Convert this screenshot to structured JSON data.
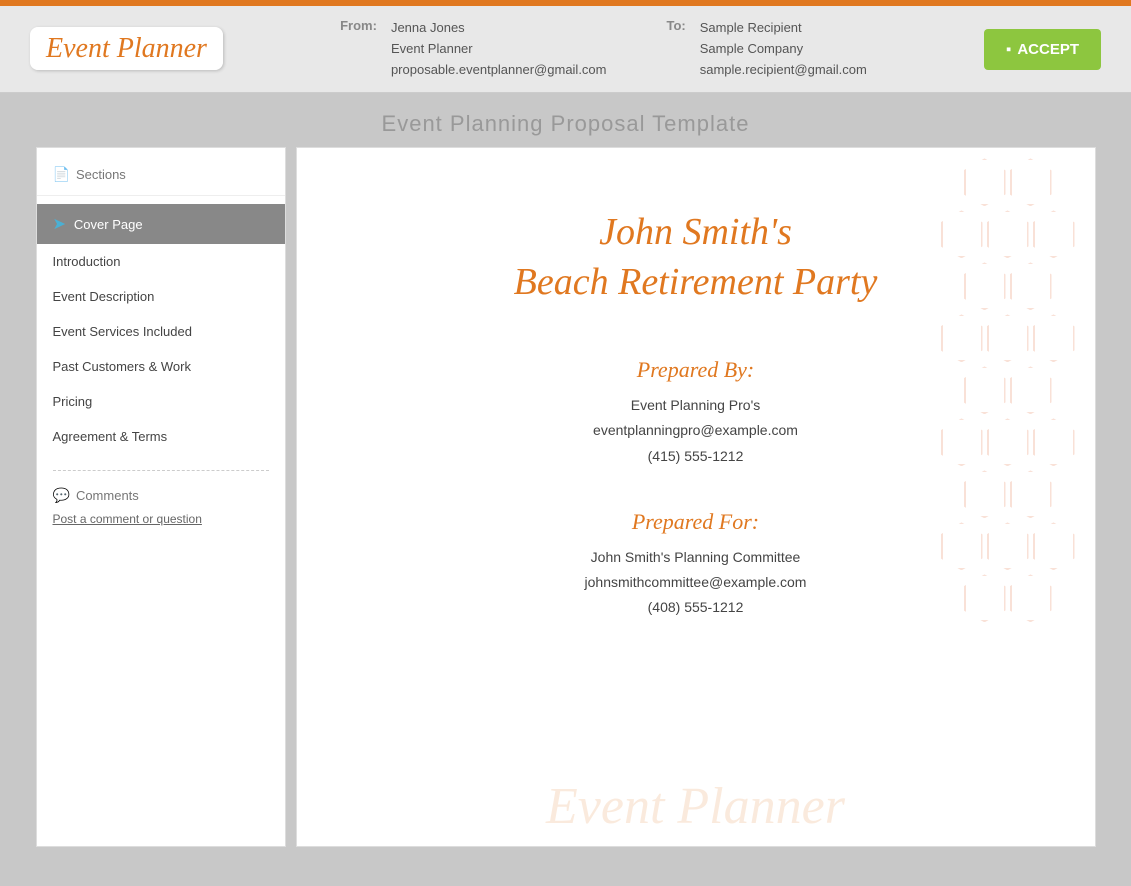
{
  "topBar": {},
  "header": {
    "logo": "Event Planner",
    "from": {
      "label": "From:",
      "name": "Jenna Jones",
      "company": "Event Planner",
      "email": "proposable.eventplanner@gmail.com"
    },
    "to": {
      "label": "To:",
      "name": "Sample Recipient",
      "company": "Sample Company",
      "email": "sample.recipient@gmail.com"
    },
    "acceptButton": "ACCEPT"
  },
  "pageTitle": "Event Planning Proposal Template",
  "sidebar": {
    "sectionsLabel": "Sections",
    "nav": [
      {
        "label": "Cover Page",
        "active": true
      },
      {
        "label": "Introduction",
        "active": false
      },
      {
        "label": "Event Description",
        "active": false
      },
      {
        "label": "Event Services Included",
        "active": false
      },
      {
        "label": "Past Customers & Work",
        "active": false
      },
      {
        "label": "Pricing",
        "active": false
      },
      {
        "label": "Agreement & Terms",
        "active": false
      }
    ],
    "commentsLabel": "Comments",
    "postCommentLink": "Post a comment or question"
  },
  "coverPage": {
    "title1": "John Smith's",
    "title2": "Beach Retirement Party",
    "preparedByLabel": "Prepared By:",
    "preparedByName": "Event Planning Pro's",
    "preparedByEmail": "eventplanningpro@example.com",
    "preparedByPhone": "(415) 555-1212",
    "preparedForLabel": "Prepared For:",
    "preparedForName": "John Smith's Planning Committee",
    "preparedForEmail": "johnsmithcommittee@example.com",
    "preparedForPhone": "(408) 555-1212",
    "watermarkLogo": "Event Planner"
  }
}
